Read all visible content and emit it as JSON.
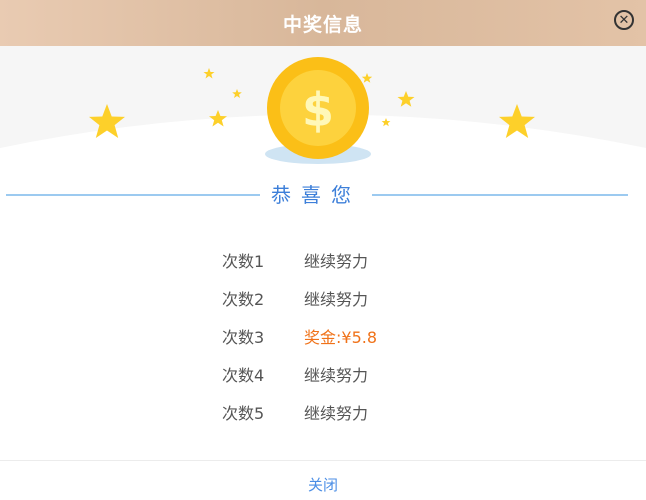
{
  "header": {
    "title": "中奖信息",
    "close_icon": "close-circle-icon"
  },
  "hero": {
    "coin_symbol": "$"
  },
  "banner": {
    "text": "恭喜您"
  },
  "results": [
    {
      "label": "次数1",
      "value": "继续努力",
      "win": false
    },
    {
      "label": "次数2",
      "value": "继续努力",
      "win": false
    },
    {
      "label": "次数3",
      "value": "奖金:¥5.8",
      "win": true
    },
    {
      "label": "次数4",
      "value": "继续努力",
      "win": false
    },
    {
      "label": "次数5",
      "value": "继续努力",
      "win": false
    }
  ],
  "footer": {
    "close_label": "关闭"
  },
  "colors": {
    "header_bg": "#dcbb9f",
    "accent_blue": "#3d7fd9",
    "win_orange": "#f07219",
    "coin_gold": "#fbbf17"
  }
}
